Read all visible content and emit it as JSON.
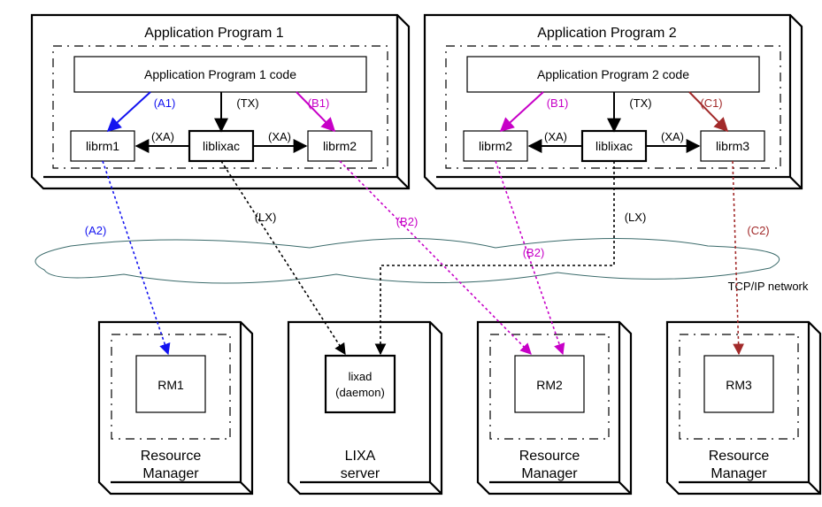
{
  "app1": {
    "title": "Application Program 1",
    "code_label": "Application Program 1 code",
    "librm1": "librm1",
    "liblixac": "liblixac",
    "librm2": "librm2",
    "a1": "(A1)",
    "tx": "(TX)",
    "b1": "(B1)",
    "xa_left": "(XA)",
    "xa_right": "(XA)"
  },
  "app2": {
    "title": "Application Program 2",
    "code_label": "Application Program 2 code",
    "librm2": "librm2",
    "liblixac": "liblixac",
    "librm3": "librm3",
    "b1": "(B1)",
    "tx": "(TX)",
    "c1": "(C1)",
    "xa_left": "(XA)",
    "xa_right": "(XA)"
  },
  "rm1": {
    "title": "Resource\nManager",
    "box": "RM1"
  },
  "lixa": {
    "title": "LIXA\nserver",
    "box_l1": "lixad",
    "box_l2": "(daemon)"
  },
  "rm2": {
    "title": "Resource\nManager",
    "box": "RM2"
  },
  "rm3": {
    "title": "Resource\nManager",
    "box": "RM3"
  },
  "edges": {
    "a2": "(A2)",
    "lx1": "(LX)",
    "b2a": "(B2)",
    "b2b": "(B2)",
    "lx2": "(LX)",
    "c2": "(C2)"
  },
  "network": "TCP/IP network",
  "colors": {
    "black": "#000000",
    "blue": "#1313f0",
    "magenta": "#c700c7",
    "brown": "#a22a2a",
    "cloud": "#3a6a6a"
  }
}
